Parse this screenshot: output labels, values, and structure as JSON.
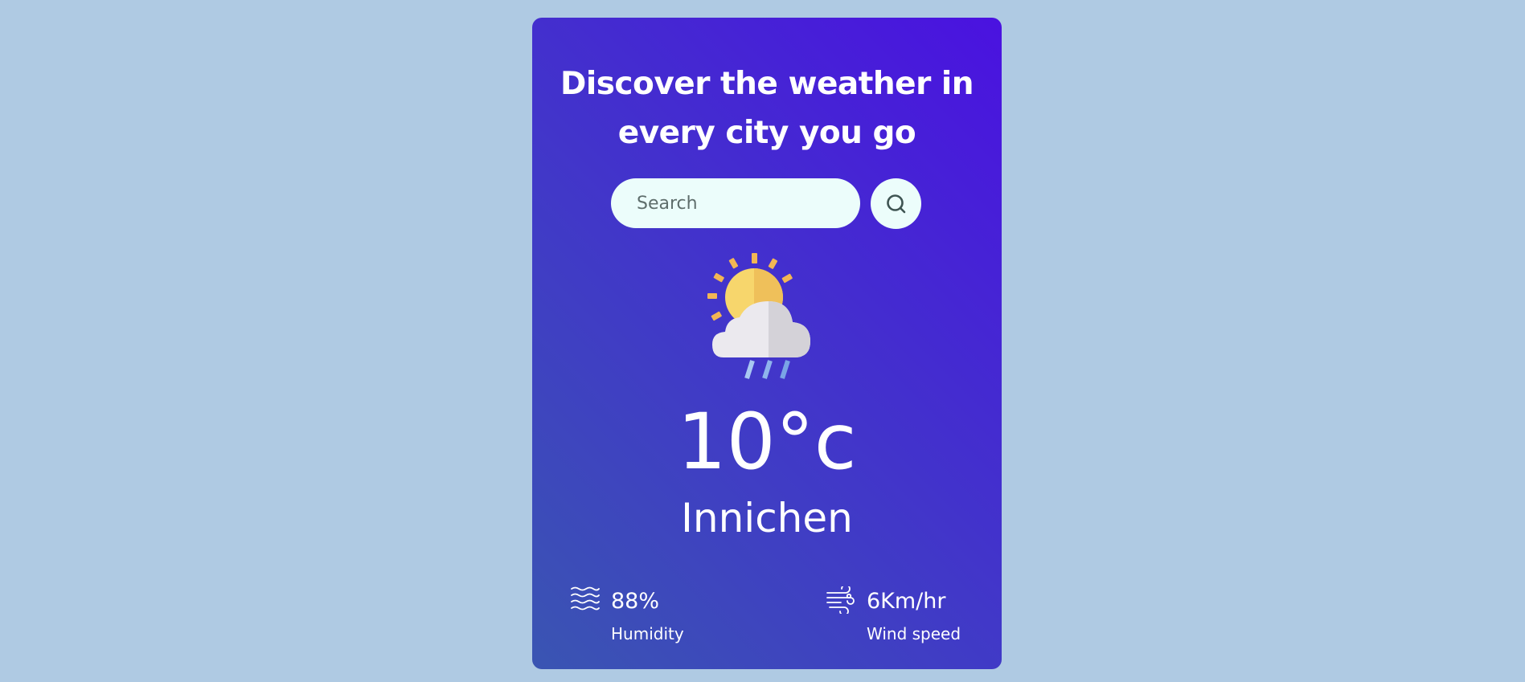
{
  "header": {
    "title_line1": "Discover the weather in",
    "title_line2": "every city you go"
  },
  "search": {
    "placeholder": "Search",
    "value": "",
    "button_icon": "search-icon"
  },
  "weather": {
    "icon": "partly-cloudy-rain-icon",
    "temperature": "10°c",
    "city": "Innichen"
  },
  "details": {
    "humidity": {
      "icon": "humidity-waves-icon",
      "value": "88%",
      "label": "Humidity"
    },
    "wind": {
      "icon": "wind-icon",
      "value": "6Km/hr",
      "label": "Wind speed"
    }
  },
  "colors": {
    "page_background": "#afcae3",
    "card_gradient_start": "#3a55b2",
    "card_gradient_end": "#4a12e0",
    "input_background": "#ecfdfb",
    "text": "#ffffff"
  }
}
